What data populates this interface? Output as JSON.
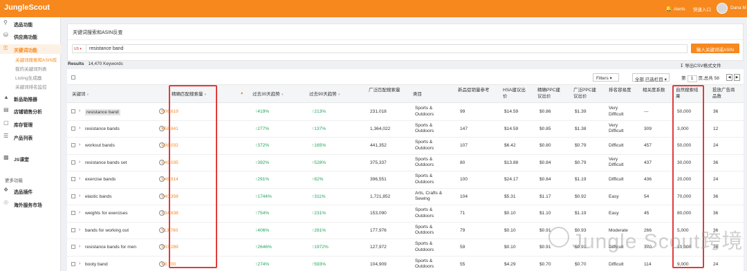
{
  "app": {
    "logo": "JungleScout",
    "alerts": "Alerts",
    "quick_entry": "快速入口",
    "username": "Dana M"
  },
  "colors": {
    "brand": "#f6881e",
    "positive": "#21a35a",
    "highlight_box": "#e03a3a"
  },
  "sidebar": {
    "items": [
      {
        "icon": "search-icon",
        "label": "选品功能"
      },
      {
        "icon": "database-icon",
        "label": "供应商功能"
      },
      {
        "icon": "key-icon",
        "label": "关键词功能",
        "active": true
      },
      {
        "icon": "chart-icon",
        "label": "新品助推器"
      },
      {
        "icon": "bar-chart-icon",
        "label": "店铺销售分析"
      },
      {
        "icon": "box-icon",
        "label": "库存管理"
      },
      {
        "icon": "list-icon",
        "label": "产品列表"
      },
      {
        "icon": "js-icon",
        "label": "JS课堂"
      },
      {
        "icon": "puzzle-icon",
        "label": "选品插件"
      },
      {
        "icon": "globe-icon",
        "label": "海外服务市场"
      }
    ],
    "sub_items": [
      {
        "label": "关键词搜索和ASIN反",
        "current": true
      },
      {
        "label": "我的关键词列表"
      },
      {
        "label": "Listing生成器"
      },
      {
        "label": "关键词排名监控"
      }
    ],
    "more_label": "更多功能"
  },
  "search_card": {
    "title": "关键词搜索和ASIN反查",
    "marketplace": "US",
    "query": "resistance band",
    "button": "输入关键词或ASIN"
  },
  "results": {
    "label": "Results",
    "count": "14,470 Keywords",
    "export": "导出CSV格式文件"
  },
  "toolbar": {
    "filters": "Filters",
    "column_select": "全部 已选栏目",
    "page_prefix": "第",
    "page": "1",
    "page_suffix": "页,总共 58"
  },
  "columns": [
    "关键词",
    "精确匹配搜索量",
    "过去30天趋势",
    "过去90天趋势",
    "广泛匹配搜索量",
    "类目",
    "新品促销量参考",
    "HSA建议出价",
    "精确PPC建议出价",
    "广泛PPC建议出价",
    "排名容易度",
    "相关度系数",
    "自然搜索结果",
    "投放广告商品数"
  ],
  "rows": [
    {
      "keyword": "resistance band",
      "exact": "106,619",
      "t30": "↑419%",
      "t90": "↑213%",
      "broad": "231,018",
      "cat1": "Sports &",
      "cat2": "Outdoors",
      "promo": "99",
      "hsa": "$14.59",
      "exact_ppc": "$0.86",
      "broad_ppc": "$1.39",
      "ease1": "Very",
      "ease2": "Difficult",
      "relevancy": "---",
      "organic": "50,000",
      "ads": "36"
    },
    {
      "keyword": "resistance bands",
      "exact": "658,841",
      "t30": "↑277%",
      "t90": "↑137%",
      "broad": "1,364,022",
      "cat1": "Sports &",
      "cat2": "Outdoors",
      "promo": "147",
      "hsa": "$14.59",
      "exact_ppc": "$0.85",
      "broad_ppc": "$1.38",
      "ease1": "Very",
      "ease2": "Difficult",
      "relevancy": "309",
      "organic": "3,000",
      "ads": "12"
    },
    {
      "keyword": "workout bands",
      "exact": "298,032",
      "t30": "↑372%",
      "t90": "↑165%",
      "broad": "441,352",
      "cat1": "Sports &",
      "cat2": "Outdoors",
      "promo": "107",
      "hsa": "$6.42",
      "exact_ppc": "$0.80",
      "broad_ppc": "$0.79",
      "ease1": "Difficult",
      "ease2": "",
      "relevancy": "457",
      "organic": "50,000",
      "ads": "24"
    },
    {
      "keyword": "resistance bands set",
      "exact": "249,035",
      "t30": "↑392%",
      "t90": "↑528%",
      "broad": "375,337",
      "cat1": "Sports &",
      "cat2": "Outdoors",
      "promo": "80",
      "hsa": "$13.88",
      "exact_ppc": "$0.84",
      "broad_ppc": "$0.79",
      "ease1": "Very",
      "ease2": "Difficult",
      "relevancy": "437",
      "organic": "30,000",
      "ads": "36"
    },
    {
      "keyword": "exercise bands",
      "exact": "248,914",
      "t30": "↑291%",
      "t90": "↑82%",
      "broad": "396,551",
      "cat1": "Sports &",
      "cat2": "Outdoors",
      "promo": "100",
      "hsa": "$24.17",
      "exact_ppc": "$0.84",
      "broad_ppc": "$1.19",
      "ease1": "Difficult",
      "ease2": "",
      "relevancy": "436",
      "organic": "20,000",
      "ads": "24"
    },
    {
      "keyword": "elastic bands",
      "exact": "140,358",
      "t30": "↑1744%",
      "t90": "↑311%",
      "broad": "1,721,852",
      "cat1": "Arts, Crafts &",
      "cat2": "Sewing",
      "promo": "104",
      "hsa": "$5.31",
      "exact_ppc": "$1.17",
      "broad_ppc": "$0.92",
      "ease1": "Easy",
      "ease2": "",
      "relevancy": "54",
      "organic": "70,000",
      "ads": "36"
    },
    {
      "keyword": "weights for exercises",
      "exact": "134,638",
      "t30": "↑754%",
      "t90": "↑231%",
      "broad": "153,090",
      "cat1": "Sports &",
      "cat2": "Outdoors",
      "promo": "71",
      "hsa": "$0.10",
      "exact_ppc": "$1.10",
      "broad_ppc": "$1.19",
      "ease1": "Easy",
      "ease2": "",
      "relevancy": "45",
      "organic": "80,000",
      "ads": "36"
    },
    {
      "keyword": "bands for working out",
      "exact": "113,760",
      "t30": "↑406%",
      "t90": "↑281%",
      "broad": "177,976",
      "cat1": "Sports &",
      "cat2": "Outdoors",
      "promo": "79",
      "hsa": "$0.10",
      "exact_ppc": "$0.91",
      "broad_ppc": "$0.93",
      "ease1": "Moderate",
      "ease2": "",
      "relevancy": "266",
      "organic": "5,000",
      "ads": "36"
    },
    {
      "keyword": "resistance bands for men",
      "exact": "103,289",
      "t30": "↑2646%",
      "t90": "↑1972%",
      "broad": "127,972",
      "cat1": "Sports &",
      "cat2": "Outdoors",
      "promo": "59",
      "hsa": "$0.10",
      "exact_ppc": "$0.91",
      "broad_ppc": "$0.91",
      "ease1": "Difficult",
      "ease2": "",
      "relevancy": "370",
      "organic": "10,000",
      "ads": "36"
    },
    {
      "keyword": "booty band",
      "exact": "98,700",
      "t30": "↑274%",
      "t90": "↑593%",
      "broad": "104,909",
      "cat1": "Sports &",
      "cat2": "Outdoors",
      "promo": "55",
      "hsa": "$4.29",
      "exact_ppc": "$0.70",
      "broad_ppc": "$0.70",
      "ease1": "Difficult",
      "ease2": "",
      "relevancy": "114",
      "organic": "9,000",
      "ads": "24"
    }
  ],
  "watermark": "Jungle Scout跨境"
}
